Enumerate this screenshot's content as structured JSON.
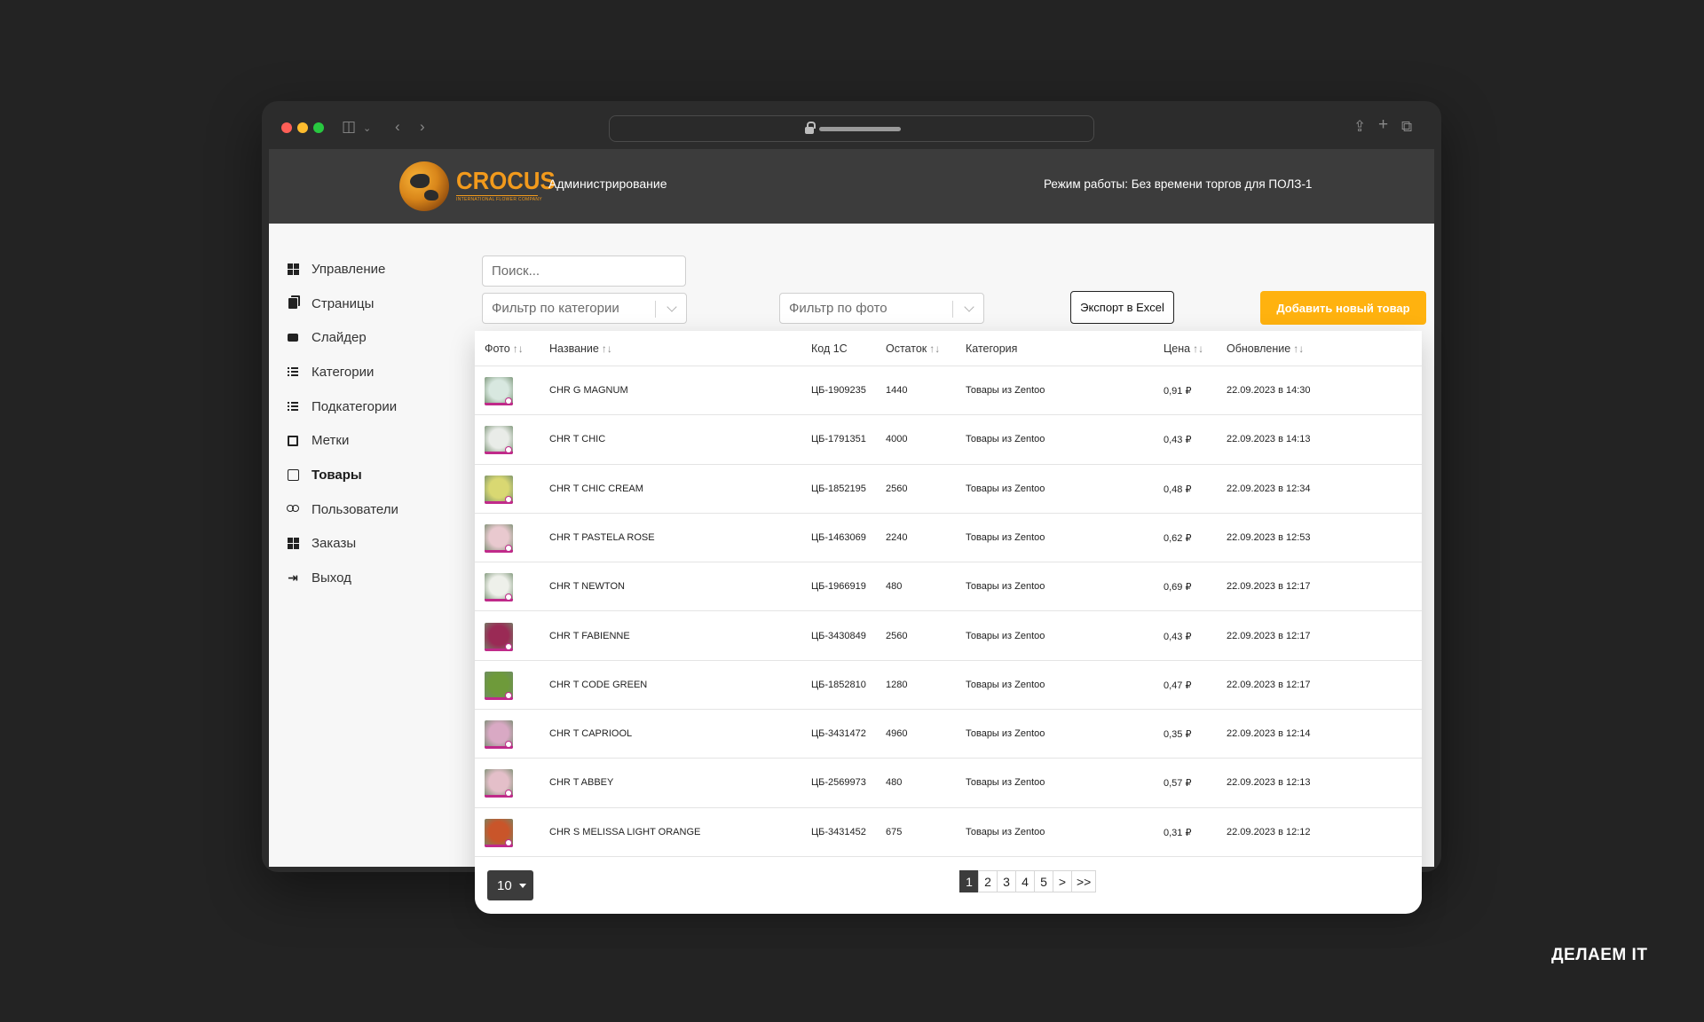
{
  "header": {
    "logo_text": "CROCUS",
    "logo_subtext": "INTERNATIONAL FLOWER COMPANY",
    "admin_label": "Администрирование",
    "mode_label": "Режим работы: Без времени торгов для ПОЛЗ-1"
  },
  "sidebar": {
    "items": [
      {
        "label": "Управление",
        "icon": "dashboard-icon",
        "active": false
      },
      {
        "label": "Страницы",
        "icon": "pages-icon",
        "active": false
      },
      {
        "label": "Слайдер",
        "icon": "slider-icon",
        "active": false
      },
      {
        "label": "Категории",
        "icon": "list-icon",
        "active": false
      },
      {
        "label": "Подкатегории",
        "icon": "list-icon",
        "active": false
      },
      {
        "label": "Метки",
        "icon": "tag-icon",
        "active": false
      },
      {
        "label": "Товары",
        "icon": "box-icon",
        "active": true
      },
      {
        "label": "Пользователи",
        "icon": "users-icon",
        "active": false
      },
      {
        "label": "Заказы",
        "icon": "orders-icon",
        "active": false
      },
      {
        "label": "Выход",
        "icon": "logout-icon",
        "active": false
      }
    ]
  },
  "toolbar": {
    "search_placeholder": "Поиск...",
    "category_filter": "Фильтр по категории",
    "photo_filter": "Фильтр по фото",
    "export_label": "Экспорт в Excel",
    "add_label": "Добавить новый товар"
  },
  "table": {
    "headers": {
      "photo": "Фото",
      "name": "Название",
      "code": "Код 1С",
      "stock": "Остаток",
      "category": "Категория",
      "price": "Цена",
      "updated": "Обновление"
    },
    "sort_glyph": "↑↓",
    "rows": [
      {
        "name": "CHR G MAGNUM",
        "code": "ЦБ-1909235",
        "stock": "1440",
        "category": "Товары из Zentoo",
        "price": "0,91 ₽",
        "updated": "22.09.2023 в 14:30",
        "color": "#d8e8e0"
      },
      {
        "name": "CHR T CHIC",
        "code": "ЦБ-1791351",
        "stock": "4000",
        "category": "Товары из Zentoo",
        "price": "0,43 ₽",
        "updated": "22.09.2023 в 14:13",
        "color": "#e9ece8"
      },
      {
        "name": "CHR T CHIC CREAM",
        "code": "ЦБ-1852195",
        "stock": "2560",
        "category": "Товары из Zentoo",
        "price": "0,48 ₽",
        "updated": "22.09.2023 в 12:34",
        "color": "#d9d872"
      },
      {
        "name": "CHR T PASTELA ROSE",
        "code": "ЦБ-1463069",
        "stock": "2240",
        "category": "Товары из Zentoo",
        "price": "0,62 ₽",
        "updated": "22.09.2023 в 12:53",
        "color": "#e9c9cf"
      },
      {
        "name": "CHR T NEWTON",
        "code": "ЦБ-1966919",
        "stock": "480",
        "category": "Товары из Zentoo",
        "price": "0,69 ₽",
        "updated": "22.09.2023 в 12:17",
        "color": "#eef0ea"
      },
      {
        "name": "CHR T FABIENNE",
        "code": "ЦБ-3430849",
        "stock": "2560",
        "category": "Товары из Zentoo",
        "price": "0,43 ₽",
        "updated": "22.09.2023 в 12:17",
        "color": "#9a2a55"
      },
      {
        "name": "CHR T CODE GREEN",
        "code": "ЦБ-1852810",
        "stock": "1280",
        "category": "Товары из Zentoo",
        "price": "0,47 ₽",
        "updated": "22.09.2023 в 12:17",
        "color": "#6e9a3a"
      },
      {
        "name": "CHR T CAPRIOOL",
        "code": "ЦБ-3431472",
        "stock": "4960",
        "category": "Товары из Zentoo",
        "price": "0,35 ₽",
        "updated": "22.09.2023 в 12:14",
        "color": "#d9a9c4"
      },
      {
        "name": "CHR T ABBEY",
        "code": "ЦБ-2569973",
        "stock": "480",
        "category": "Товары из Zentoo",
        "price": "0,57 ₽",
        "updated": "22.09.2023 в 12:13",
        "color": "#e4bfc9"
      },
      {
        "name": "CHR S MELISSA LIGHT ORANGE",
        "code": "ЦБ-3431452",
        "stock": "675",
        "category": "Товары из Zentoo",
        "price": "0,31 ₽",
        "updated": "22.09.2023 в 12:12",
        "color": "#c9552a"
      }
    ]
  },
  "footer": {
    "per_page": "10",
    "pages": [
      "1",
      "2",
      "3",
      "4",
      "5",
      ">",
      ">>"
    ],
    "active_page": "1"
  },
  "brand": "ДЕЛАЕМ IT",
  "colors": {
    "accent": "#ffb20f",
    "header_bg": "#3c3c3c",
    "logo": "#f29a1c"
  }
}
